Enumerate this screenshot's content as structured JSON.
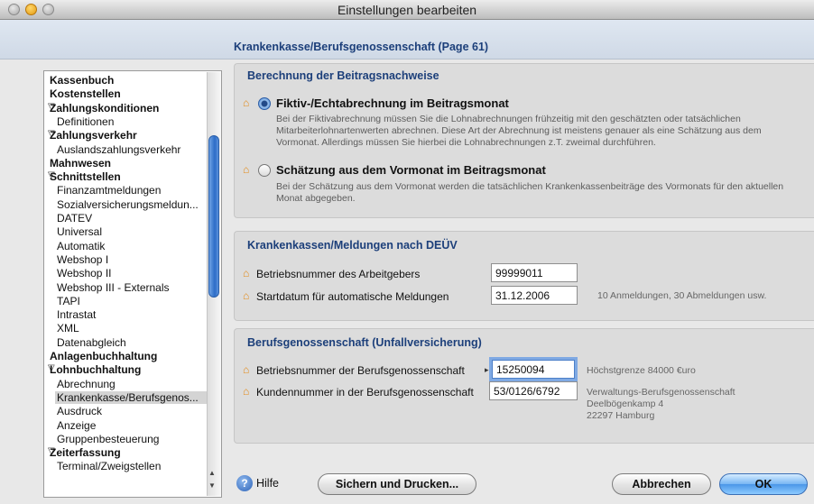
{
  "window": {
    "title": "Einstellungen bearbeiten"
  },
  "page": {
    "title": "Krankenkasse/Berufsgenossenschaft (Page 61)"
  },
  "sidebar": {
    "items": [
      {
        "label": "Kassenbuch",
        "level": 0,
        "bold": true
      },
      {
        "label": "Kostenstellen",
        "level": 0,
        "bold": true
      },
      {
        "label": "Zahlungskonditionen",
        "level": 0,
        "bold": true,
        "expanded": true
      },
      {
        "label": "Definitionen",
        "level": 1
      },
      {
        "label": "Zahlungsverkehr",
        "level": 0,
        "bold": true,
        "expanded": true
      },
      {
        "label": "Auslandszahlungsverkehr",
        "level": 1
      },
      {
        "label": "Mahnwesen",
        "level": 0,
        "bold": true
      },
      {
        "label": "Schnittstellen",
        "level": 0,
        "bold": true,
        "expanded": true
      },
      {
        "label": "Finanzamtmeldungen",
        "level": 1
      },
      {
        "label": "Sozialversicherungsmeldun...",
        "level": 1
      },
      {
        "label": "DATEV",
        "level": 1
      },
      {
        "label": "Universal",
        "level": 1
      },
      {
        "label": "Automatik",
        "level": 1
      },
      {
        "label": "Webshop I",
        "level": 1
      },
      {
        "label": "Webshop II",
        "level": 1
      },
      {
        "label": "Webshop III - Externals",
        "level": 1
      },
      {
        "label": "TAPI",
        "level": 1
      },
      {
        "label": "Intrastat",
        "level": 1
      },
      {
        "label": "XML",
        "level": 1
      },
      {
        "label": "Datenabgleich",
        "level": 1
      },
      {
        "label": "Anlagenbuchhaltung",
        "level": 0,
        "bold": true
      },
      {
        "label": "Lohnbuchhaltung",
        "level": 0,
        "bold": true,
        "expanded": true
      },
      {
        "label": "Abrechnung",
        "level": 1
      },
      {
        "label": "Krankenkasse/Berufsgenos...",
        "level": 1,
        "selected": true
      },
      {
        "label": "Ausdruck",
        "level": 1
      },
      {
        "label": "Anzeige",
        "level": 1
      },
      {
        "label": "Gruppenbesteuerung",
        "level": 1
      },
      {
        "label": "Zeiterfassung",
        "level": 0,
        "bold": true,
        "expanded": true
      },
      {
        "label": "Terminal/Zweigstellen",
        "level": 1
      }
    ]
  },
  "beitrag": {
    "title": "Berechnung der Beitragsnachweise",
    "option1": {
      "label": "Fiktiv-/Echtabrechnung im Beitragsmonat",
      "selected": true,
      "desc": "Bei der Fiktivabrechnung müssen Sie die Lohnabrechnungen frühzeitig mit den geschätzten oder tatsächlichen Mitarbeiterlohnartenwerten abrechnen. Diese Art der Abrechnung ist meistens genauer als eine Schätzung aus dem Vormonat. Allerdings müssen Sie hierbei die Lohnabrechnungen z.T. zweimal durchführen."
    },
    "option2": {
      "label": "Schätzung aus dem Vormonat im Beitragsmonat",
      "selected": false,
      "desc": "Bei der Schätzung aus dem Vormonat werden die tatsächlichen Krankenkassenbeiträge des Vormonats für den aktuellen Monat abgegeben."
    }
  },
  "deuev": {
    "title": "Krankenkassen/Meldungen nach DEÜV",
    "betriebsnummer_label": "Betriebsnummer des Arbeitgebers",
    "betriebsnummer_value": "99999011",
    "startdatum_label": "Startdatum für automatische Meldungen",
    "startdatum_value": "31.12.2006",
    "startdatum_hint": "10 Anmeldungen, 30 Abmeldungen usw."
  },
  "bg": {
    "title": "Berufsgenossenschaft (Unfallversicherung)",
    "betriebsnummer_label": "Betriebsnummer der Berufsgenossenschaft",
    "betriebsnummer_value": "15250094",
    "betriebsnummer_hint": "Höchstgrenze 84000 €uro",
    "kundennummer_label": "Kundennummer in der Berufsgenossenschaft",
    "kundennummer_value": "53/0126/6792",
    "address_line1": "Verwaltungs-Berufsgenossenschaft",
    "address_line2": "Deelbögenkamp 4",
    "address_line3": "22297 Hamburg"
  },
  "footer": {
    "help_label": "Hilfe",
    "save_print_label": "Sichern und Drucken...",
    "cancel_label": "Abbrechen",
    "ok_label": "OK"
  },
  "icons": {
    "required_marker": "house-outline",
    "help": "question-mark-circle",
    "disclosure": "triangle-down"
  },
  "colors": {
    "section_title": "#1c3f7a",
    "required_marker": "#e38a16",
    "default_button": "#4b97e8"
  }
}
